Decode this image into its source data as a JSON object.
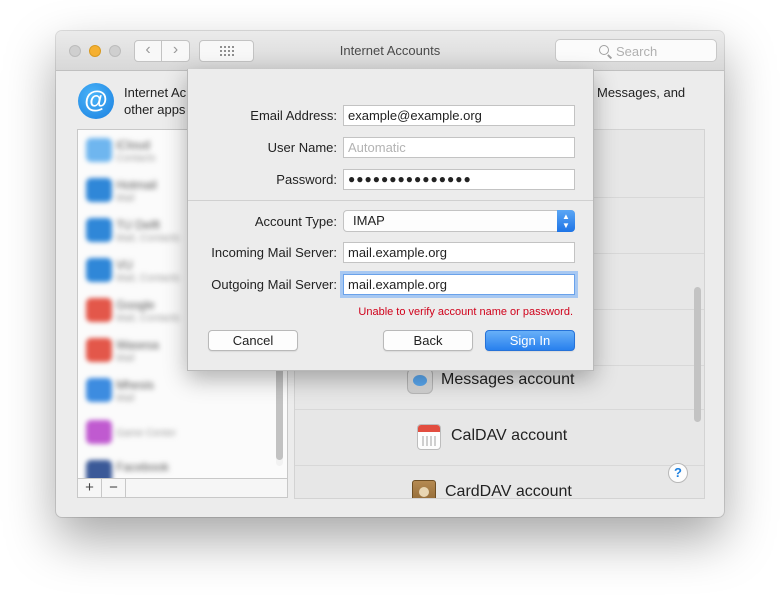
{
  "window": {
    "title": "Internet Accounts",
    "search_placeholder": "Search"
  },
  "header": {
    "icon_glyph": "@",
    "line1_left": "Internet Ac",
    "line1_right": "Messages, and",
    "line2_left": "other apps"
  },
  "sidebar": {
    "items": [
      {
        "name": "iCloud",
        "sub": "Contacts",
        "icon_color": "#6fb6ef"
      },
      {
        "name": "Hotmail",
        "sub": "Mail",
        "icon_color": "#2f87d8"
      },
      {
        "name": "TU Delft",
        "sub": "Mail, Contacts",
        "icon_color": "#2f87d8"
      },
      {
        "name": "VU",
        "sub": "Mail, Contacts",
        "icon_color": "#2f87d8"
      },
      {
        "name": "Google",
        "sub": "Mail, Contacts",
        "icon_color": "#e3574a"
      },
      {
        "name": "Wasesa",
        "sub": "Mail",
        "icon_color": "#e3574a"
      },
      {
        "name": "Mhesis",
        "sub": "Mail",
        "icon_color": "#3d8ce0"
      },
      {
        "name": "",
        "sub": "Game Center",
        "icon_color": "#c05ad0"
      },
      {
        "name": "Facebook",
        "sub": "",
        "icon_color": "#3b5998"
      }
    ],
    "add_glyph": "+",
    "remove_glyph": "−"
  },
  "content": {
    "rows": [
      {
        "label": "Messages account",
        "icon": "messages-icon"
      },
      {
        "label": "CalDAV account",
        "icon": "calendar-icon"
      },
      {
        "label": "CardDAV account",
        "icon": "contacts-icon"
      }
    ],
    "help_glyph": "?"
  },
  "sheet": {
    "email_label": "Email Address:",
    "email_value": "example@example.org",
    "username_label": "User Name:",
    "username_placeholder": "Automatic",
    "password_label": "Password:",
    "password_value": "●●●●●●●●●●●●●●●",
    "account_type_label": "Account Type:",
    "account_type_value": "IMAP",
    "incoming_label": "Incoming Mail Server:",
    "incoming_value": "mail.example.org",
    "outgoing_label": "Outgoing Mail Server:",
    "outgoing_value": "mail.example.org",
    "error_text": "Unable to verify account name or password.",
    "cancel_label": "Cancel",
    "back_label": "Back",
    "signin_label": "Sign In"
  },
  "colors": {
    "accent": "#2880ee",
    "error": "#d0021b",
    "minimize": "#f5b031"
  }
}
